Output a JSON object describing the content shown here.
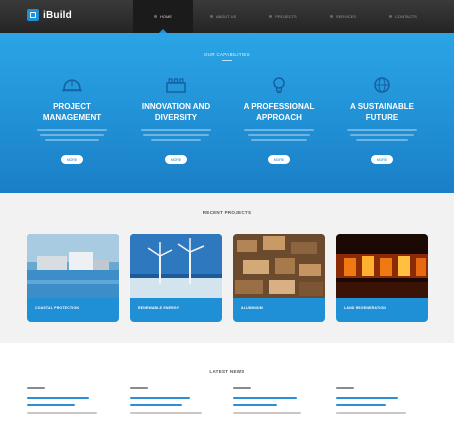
{
  "header": {
    "logo_text": "iBuild",
    "nav": [
      "Home",
      "About Us",
      "Projects",
      "Services",
      "Contacts"
    ]
  },
  "capabilities": {
    "title": "Our Capabilities",
    "items": [
      {
        "title_line1": "Project",
        "title_line2": "Management",
        "icon": "hard-hat-icon",
        "button": "More"
      },
      {
        "title_line1": "Innovation and",
        "title_line2": "Diversity",
        "icon": "factory-icon",
        "button": "More"
      },
      {
        "title_line1": "A Professional",
        "title_line2": "Approach",
        "icon": "lightbulb-icon",
        "button": "More"
      },
      {
        "title_line1": "A Sustainable",
        "title_line2": "Future",
        "icon": "globe-icon",
        "button": "More"
      }
    ]
  },
  "projects": {
    "title": "Recent Projects",
    "items": [
      {
        "label": "Coastal Protection"
      },
      {
        "label": "Renewable Energy"
      },
      {
        "label": "Aluminium"
      },
      {
        "label": "Land Regeneration"
      }
    ]
  },
  "news": {
    "title": "Latest News"
  },
  "colors": {
    "accent": "#1f8fd6",
    "header_bg": "#2d2d2d",
    "band_top": "#2aa5e6",
    "band_bottom": "#1a7fc7"
  }
}
